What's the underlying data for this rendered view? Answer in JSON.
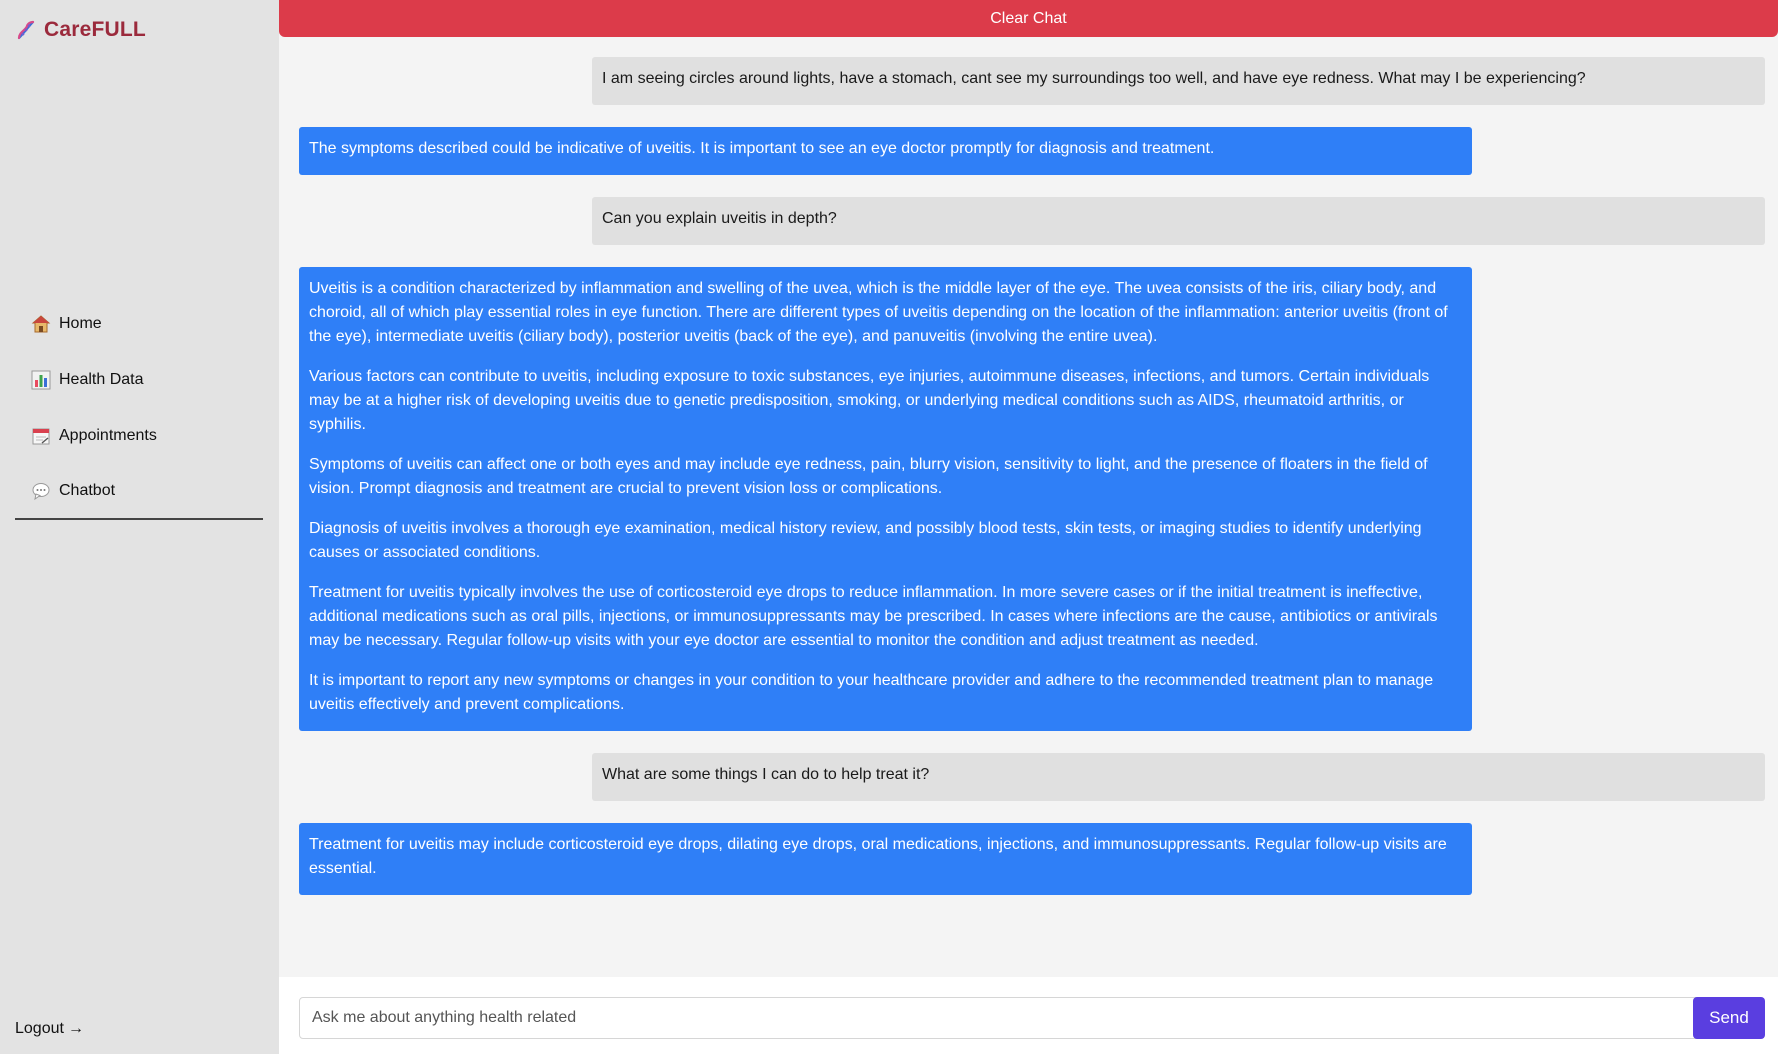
{
  "brand": {
    "name": "CareFULL",
    "icon": "dna-icon",
    "color": "#9b2a3c"
  },
  "nav": {
    "items": [
      {
        "label": "Home",
        "icon": "house-icon"
      },
      {
        "label": "Health Data",
        "icon": "bar-chart-icon"
      },
      {
        "label": "Appointments",
        "icon": "calendar-icon"
      },
      {
        "label": "Chatbot",
        "icon": "speech-bubble-icon",
        "active": true
      }
    ]
  },
  "logout": {
    "label": "Logout",
    "arrow": "→"
  },
  "header": {
    "clear_label": "Clear Chat",
    "color": "#dc3b4a"
  },
  "messages": [
    {
      "role": "user",
      "paragraphs": [
        "I am seeing circles around lights, have a stomach, cant see my surroundings too well, and have eye redness. What may I be experiencing?"
      ]
    },
    {
      "role": "bot",
      "paragraphs": [
        "The symptoms described could be indicative of uveitis. It is important to see an eye doctor promptly for diagnosis and treatment."
      ]
    },
    {
      "role": "user",
      "paragraphs": [
        "Can you explain uveitis in depth?"
      ]
    },
    {
      "role": "bot",
      "paragraphs": [
        "Uveitis is a condition characterized by inflammation and swelling of the uvea, which is the middle layer of the eye. The uvea consists of the iris, ciliary body, and choroid, all of which play essential roles in eye function. There are different types of uveitis depending on the location of the inflammation: anterior uveitis (front of the eye), intermediate uveitis (ciliary body), posterior uveitis (back of the eye), and panuveitis (involving the entire uvea).",
        "Various factors can contribute to uveitis, including exposure to toxic substances, eye injuries, autoimmune diseases, infections, and tumors. Certain individuals may be at a higher risk of developing uveitis due to genetic predisposition, smoking, or underlying medical conditions such as AIDS, rheumatoid arthritis, or syphilis.",
        "Symptoms of uveitis can affect one or both eyes and may include eye redness, pain, blurry vision, sensitivity to light, and the presence of floaters in the field of vision. Prompt diagnosis and treatment are crucial to prevent vision loss or complications.",
        "Diagnosis of uveitis involves a thorough eye examination, medical history review, and possibly blood tests, skin tests, or imaging studies to identify underlying causes or associated conditions.",
        "Treatment for uveitis typically involves the use of corticosteroid eye drops to reduce inflammation. In more severe cases or if the initial treatment is ineffective, additional medications such as oral pills, injections, or immunosuppressants may be prescribed. In cases where infections are the cause, antibiotics or antivirals may be necessary. Regular follow-up visits with your eye doctor are essential to monitor the condition and adjust treatment as needed.",
        "It is important to report any new symptoms or changes in your condition to your healthcare provider and adhere to the recommended treatment plan to manage uveitis effectively and prevent complications."
      ]
    },
    {
      "role": "user",
      "paragraphs": [
        "What are some things I can do to help treat it?"
      ]
    },
    {
      "role": "bot",
      "paragraphs": [
        "Treatment for uveitis may include corticosteroid eye drops, dilating eye drops, oral medications, injections, and immunosuppressants. Regular follow-up visits are essential."
      ]
    }
  ],
  "input": {
    "placeholder": "Ask me about anything health related",
    "value": ""
  },
  "send_label": "Send",
  "colors": {
    "user_bubble": "#e0e0e0",
    "bot_bubble": "#2f7ff7",
    "send": "#5a3ee0"
  }
}
